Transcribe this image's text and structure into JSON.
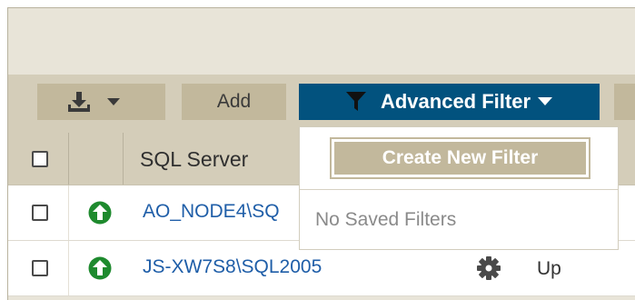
{
  "toolbar": {
    "export_icon": "download-icon",
    "export_caret_icon": "caret-down-icon",
    "add_label": "Add",
    "filter_icon": "funnel-icon",
    "advanced_filter_label": "Advanced Filter",
    "filter_caret_icon": "caret-down-icon"
  },
  "grid": {
    "columns": [
      "",
      "",
      "SQL Server"
    ],
    "rows": [
      {
        "status_icon": "up-arrow-circle-icon",
        "server": "AO_NODE4\\SQ",
        "gear_icon": null,
        "status": ""
      },
      {
        "status_icon": "up-arrow-circle-icon",
        "server": "JS-XW7S8\\SQL2005",
        "gear_icon": "gear-icon",
        "status": "Up"
      }
    ]
  },
  "filter_dropdown": {
    "create_label": "Create New Filter",
    "empty_text": "No Saved Filters"
  },
  "colors": {
    "primary": "#02527e",
    "toolbar_bg": "#d4cdb9",
    "button_bg": "#c2b89c",
    "status_up": "#1e8a2e",
    "link": "#1f5ea8"
  }
}
